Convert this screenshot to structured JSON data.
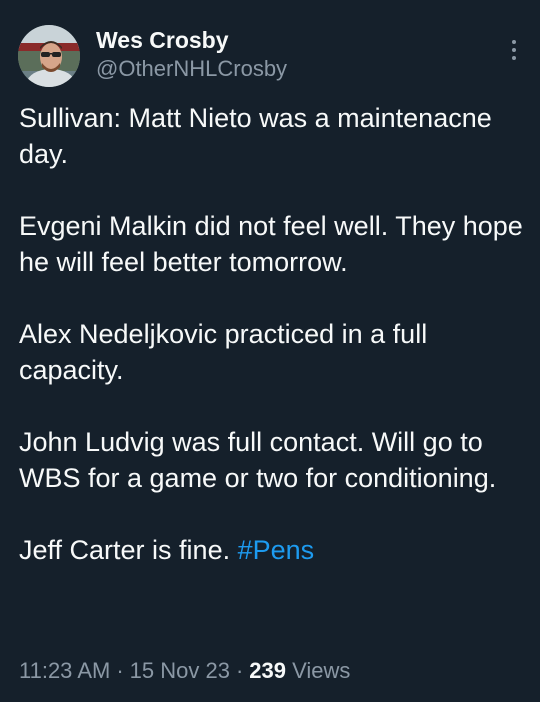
{
  "author": {
    "display_name": "Wes Crosby",
    "handle": "@OtherNHLCrosby"
  },
  "more_icon": "more-vertical-icon",
  "tweet": {
    "paragraphs": [
      "Sullivan: Matt Nieto was a maintenacne day.",
      "Evgeni Malkin did not feel well. They hope he will feel better tomorrow.",
      "Alex Nedeljkovic practiced in a full capacity.",
      "John Ludvig was full contact. Will go to WBS for a game or two for conditioning."
    ],
    "last_line_text": "Jeff Carter is fine. ",
    "hashtag": "#Pens"
  },
  "meta": {
    "time": "11:23 AM",
    "separator": "·",
    "date": "15 Nov 23",
    "views_count": "239",
    "views_label": " Views"
  },
  "colors": {
    "background": "#15202b",
    "text": "#f7f9f9",
    "secondary_text": "#8b98a5",
    "link": "#1d9bf0"
  }
}
